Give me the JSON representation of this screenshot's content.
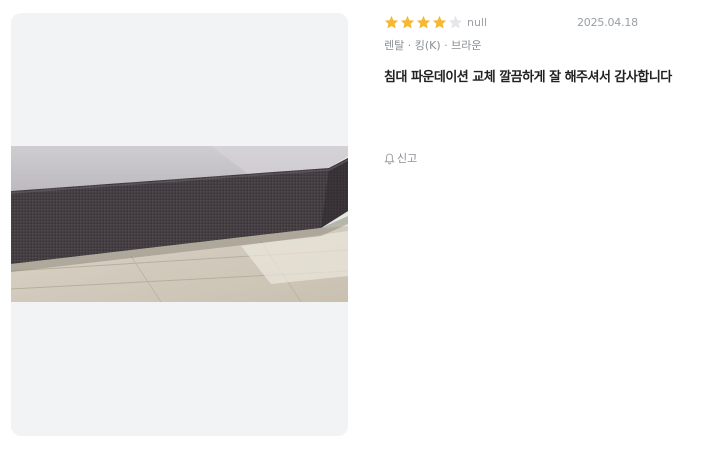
{
  "review": {
    "rating": 4,
    "rating_max": 5,
    "author": "null",
    "date": "2025.04.18",
    "option": "렌탈 · 킹(K) · 브라운",
    "content": "침대 파운데이션 교체 깔끔하게 잘 해주셔서 감사합니다",
    "report_label": "신고"
  },
  "icons": {
    "star_filled": "star-icon",
    "star_empty": "star-empty-icon",
    "report": "bell-icon"
  },
  "colors": {
    "star_filled": "#f5b82e",
    "star_empty": "#e4e6ea",
    "muted_text": "#9aa0a6",
    "body_text": "#222222",
    "photo_bg": "#f2f3f5"
  }
}
